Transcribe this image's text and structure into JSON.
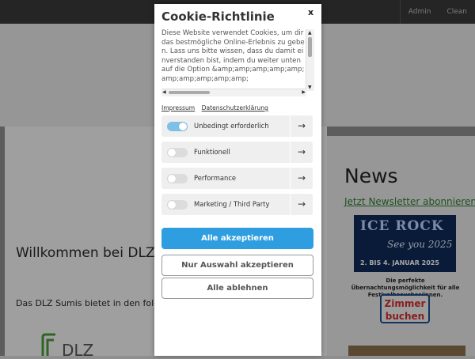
{
  "background": {
    "nav": [
      "Admin",
      "Clean"
    ],
    "welcome_title": "Willkommen bei DLZ S",
    "intro_text": "Das DLZ Sumis bietet in den folgenc",
    "logo_text": "DLZ",
    "news_title": "News",
    "newsletter_link": "Jetzt Newsletter abonnieren!",
    "banner": {
      "title": "ICE ROCK",
      "subtitle": "See you 2025",
      "dates": "2. BIS 4. JANUAR 2025"
    },
    "accommodation_text": "Die perfekte Übernachtungsmöglichkeit für alle Festivalbesucher/innen.",
    "book_button": "Zimmer buchen"
  },
  "cookie_modal": {
    "title": "Cookie-Richtlinie",
    "close_label": "x",
    "description": "Diese Website verwendet Cookies, um dir das bestmögliche Online-Erlebnis zu geben. Lass uns bitte wissen, dass du damit einverstanden bist, indem du weiter unten auf die Option &amp;amp;amp;amp;amp;amp;amp;amp;amp;amp;",
    "links": {
      "imprint": "Impressum",
      "privacy": "Datenschutzerklärung"
    },
    "categories": [
      {
        "label": "Unbedingt erforderlich",
        "enabled": true
      },
      {
        "label": "Funktionell",
        "enabled": false
      },
      {
        "label": "Performance",
        "enabled": false
      },
      {
        "label": "Marketing / Third Party",
        "enabled": false
      }
    ],
    "buttons": {
      "accept_all": "Alle akzeptieren",
      "accept_selection": "Nur Auswahl akzeptieren",
      "reject_all": "Alle ablehnen"
    },
    "colors": {
      "primary": "#2e9ee0",
      "toggle_on": "#7fc0e7",
      "toggle_off": "#dcdcdc"
    }
  }
}
